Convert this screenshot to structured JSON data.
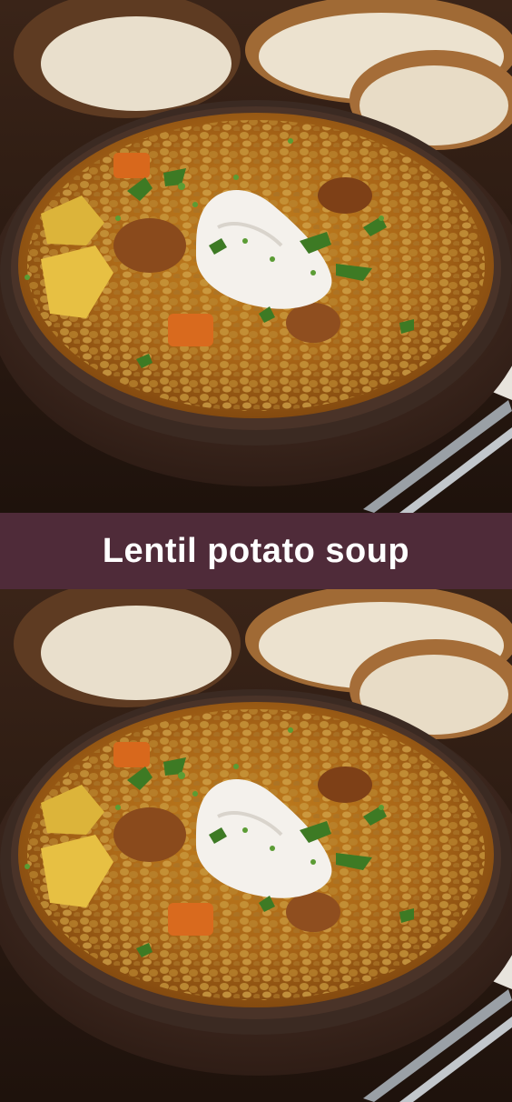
{
  "banner": {
    "title": "Lentil potato soup",
    "background": "#4f2b39",
    "text_color": "#ffffff"
  },
  "photos": [
    {
      "name": "lentil-soup-photo-top"
    },
    {
      "name": "lentil-soup-photo-bottom"
    }
  ]
}
